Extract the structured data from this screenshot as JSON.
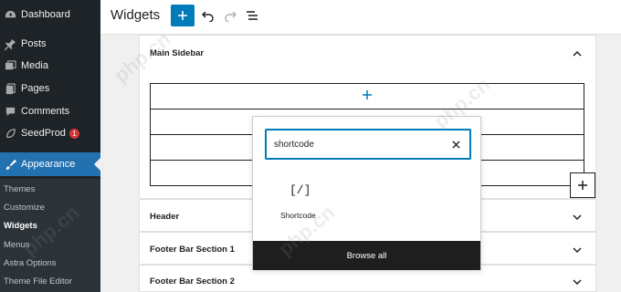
{
  "sidebar": {
    "items": [
      {
        "label": "Dashboard",
        "icon": "dashboard-icon"
      },
      {
        "label": "Posts",
        "icon": "pin-icon"
      },
      {
        "label": "Media",
        "icon": "media-icon"
      },
      {
        "label": "Pages",
        "icon": "pages-icon"
      },
      {
        "label": "Comments",
        "icon": "comments-icon"
      },
      {
        "label": "SeedProd",
        "icon": "seedprod-icon",
        "badge": "1"
      },
      {
        "label": "Appearance",
        "icon": "appearance-icon",
        "active": true
      }
    ],
    "submenu": [
      "Themes",
      "Customize",
      "Widgets",
      "Menus",
      "Astra Options",
      "Theme File Editor"
    ],
    "current_submenu": "Widgets"
  },
  "header": {
    "title": "Widgets"
  },
  "panels": {
    "main_sidebar": "Main Sidebar",
    "header": "Header",
    "footer_1": "Footer Bar Section 1",
    "footer_2": "Footer Bar Section 2"
  },
  "inserter": {
    "search_value": "shortcode",
    "result_icon": "[/]",
    "result_label": "Shortcode",
    "browse_all": "Browse all"
  },
  "watermark": "php.cn",
  "colors": {
    "sidebar_bg": "#1d2327",
    "accent": "#2271b1",
    "button_blue": "#007cba",
    "badge_red": "#d63638"
  }
}
